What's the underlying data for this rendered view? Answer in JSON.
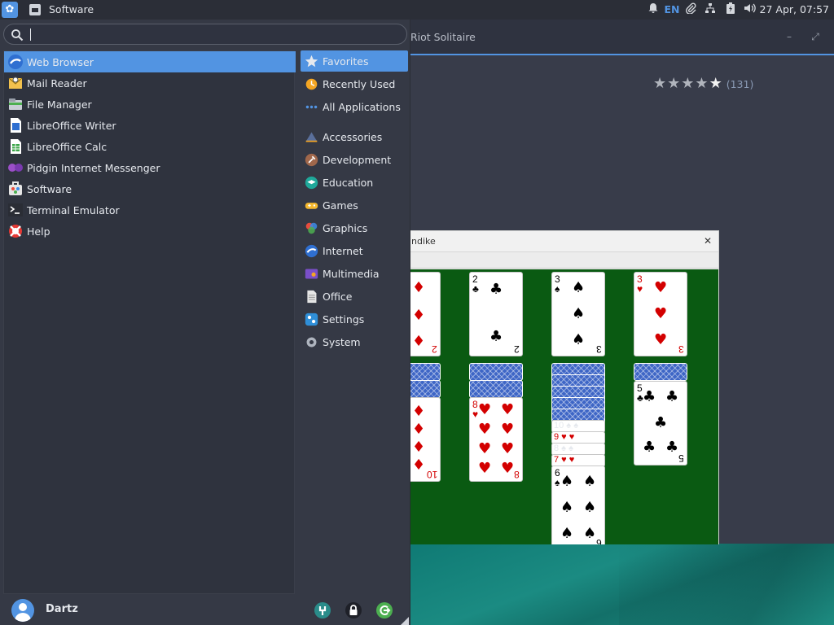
{
  "top_panel": {
    "active_app": "Software",
    "language": "EN",
    "clock": "27 Apr, 07:57",
    "icons": [
      "whisker-menu-icon",
      "notification-bell-icon",
      "clip-icon",
      "network-icon",
      "battery-icon",
      "volume-icon"
    ]
  },
  "menu": {
    "search": {
      "value": "",
      "placeholder": ""
    },
    "favorites": [
      {
        "label": "Web Browser",
        "icon": "web-browser-icon",
        "selected": true
      },
      {
        "label": "Mail Reader",
        "icon": "mail-reader-icon",
        "selected": false
      },
      {
        "label": "File Manager",
        "icon": "file-manager-icon",
        "selected": false
      },
      {
        "label": "LibreOffice Writer",
        "icon": "libreoffice-writer-icon",
        "selected": false
      },
      {
        "label": "LibreOffice Calc",
        "icon": "libreoffice-calc-icon",
        "selected": false
      },
      {
        "label": "Pidgin Internet Messenger",
        "icon": "pidgin-icon",
        "selected": false
      },
      {
        "label": "Software",
        "icon": "software-icon",
        "selected": false
      },
      {
        "label": "Terminal Emulator",
        "icon": "terminal-icon",
        "selected": false
      },
      {
        "label": "Help",
        "icon": "help-icon",
        "selected": false
      }
    ],
    "categories": [
      {
        "label": "Favorites",
        "icon": "star-icon",
        "selected": true
      },
      {
        "label": "Recently Used",
        "icon": "clock-icon",
        "selected": false
      },
      {
        "label": "All Applications",
        "icon": "all-applications-icon",
        "selected": false
      },
      {
        "label": "Accessories",
        "icon": "accessories-icon",
        "selected": false
      },
      {
        "label": "Development",
        "icon": "development-icon",
        "selected": false
      },
      {
        "label": "Education",
        "icon": "education-icon",
        "selected": false
      },
      {
        "label": "Games",
        "icon": "games-icon",
        "selected": false
      },
      {
        "label": "Graphics",
        "icon": "graphics-icon",
        "selected": false
      },
      {
        "label": "Internet",
        "icon": "internet-icon",
        "selected": false
      },
      {
        "label": "Multimedia",
        "icon": "multimedia-icon",
        "selected": false
      },
      {
        "label": "Office",
        "icon": "office-icon",
        "selected": false
      },
      {
        "label": "Settings",
        "icon": "settings-icon",
        "selected": false
      },
      {
        "label": "System",
        "icon": "system-icon",
        "selected": false
      }
    ],
    "user": {
      "name": "Dartz"
    },
    "footer_actions": [
      "settings-manager-icon",
      "lock-screen-icon",
      "log-out-icon"
    ]
  },
  "software_window": {
    "title": "Riot Solitaire",
    "rating_stars": 5,
    "rating_count": "(131)"
  },
  "klondike_window": {
    "title": "ndike"
  },
  "colors": {
    "accent": "#5294e2",
    "panel": "#2b2e37",
    "menu_bg": "#353945",
    "felt": "#0a5a12",
    "card_red": "#d30000"
  }
}
